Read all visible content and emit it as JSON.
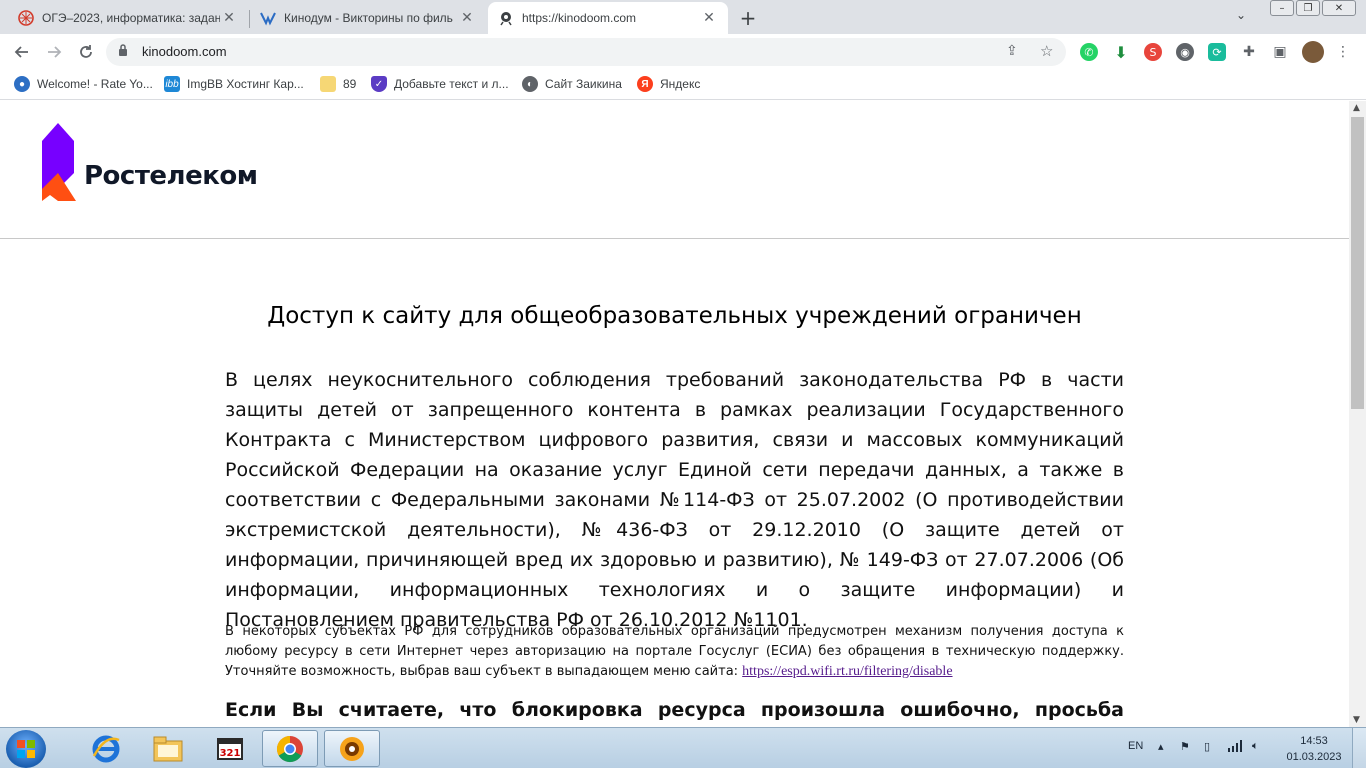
{
  "browser": {
    "tabs": [
      {
        "title": "ОГЭ–2023, информатика: задани",
        "icon": "sdamgia-icon"
      },
      {
        "title": "Кинодум - Викторины по филь",
        "icon": "kinodoom-icon"
      },
      {
        "title": "https://kinodoom.com",
        "icon": "page-icon"
      }
    ],
    "url": "kinodoom.com",
    "bookmarks": [
      {
        "label": "Welcome! - Rate Yo...",
        "icon": "globe-icon"
      },
      {
        "label": "ImgBB Хостинг Кар...",
        "icon": "imgbb-icon"
      },
      {
        "label": "89",
        "icon": "folder-icon"
      },
      {
        "label": "Добавьте текст и л...",
        "icon": "shield-icon"
      },
      {
        "label": "Сайт Заикина",
        "icon": "globe-icon"
      },
      {
        "label": "Яндекс",
        "icon": "yandex-icon"
      }
    ]
  },
  "page": {
    "logo_text": "Ростелеком",
    "heading": "Доступ к сайту для общеобразовательных учреждений ограничен",
    "paragraph1": "В целях неукоснительного соблюдения требований законодательства РФ в части защиты детей от запрещенного контента в рамках реализации Государственного Контракта с Министерством цифрового развития, связи и массовых коммуникаций Российской Федерации на оказание услуг Единой сети передачи данных, а также в соответствии с Федеральными законами №114-ФЗ от 25.07.2002 (О противодействии экстремистской деятельности), №436-ФЗ от 29.12.2010 (О защите детей от информации, причиняющей вред их здоровью и развитию), № 149-ФЗ от 27.07.2006 (Об информации, информационных технологиях и о защите информации) и Постановлением правительства РФ от 26.10.2012 №1101.",
    "paragraph2": "В некоторых субъектах РФ для сотрудников образовательных организаций предусмотрен механизм получения доступа к любому ресурсу в сети Интернет через авторизацию на портале Госуслуг (ЕСИА) без обращения в техническую поддержку. Уточняйте возможность, выбрав ваш субъект в выпадающем меню сайта: ",
    "link": "https://espd.wifi.rt.ru/filtering/disable",
    "paragraph3": "Если Вы считаете, что блокировка ресурса произошла ошибочно, просьба обратиться в"
  },
  "taskbar": {
    "language": "EN",
    "time": "14:53",
    "date": "01.03.2023"
  },
  "colors": {
    "logo_purple": "#7700ff",
    "logo_orange": "#ff4f12",
    "link": "#551a8b"
  }
}
